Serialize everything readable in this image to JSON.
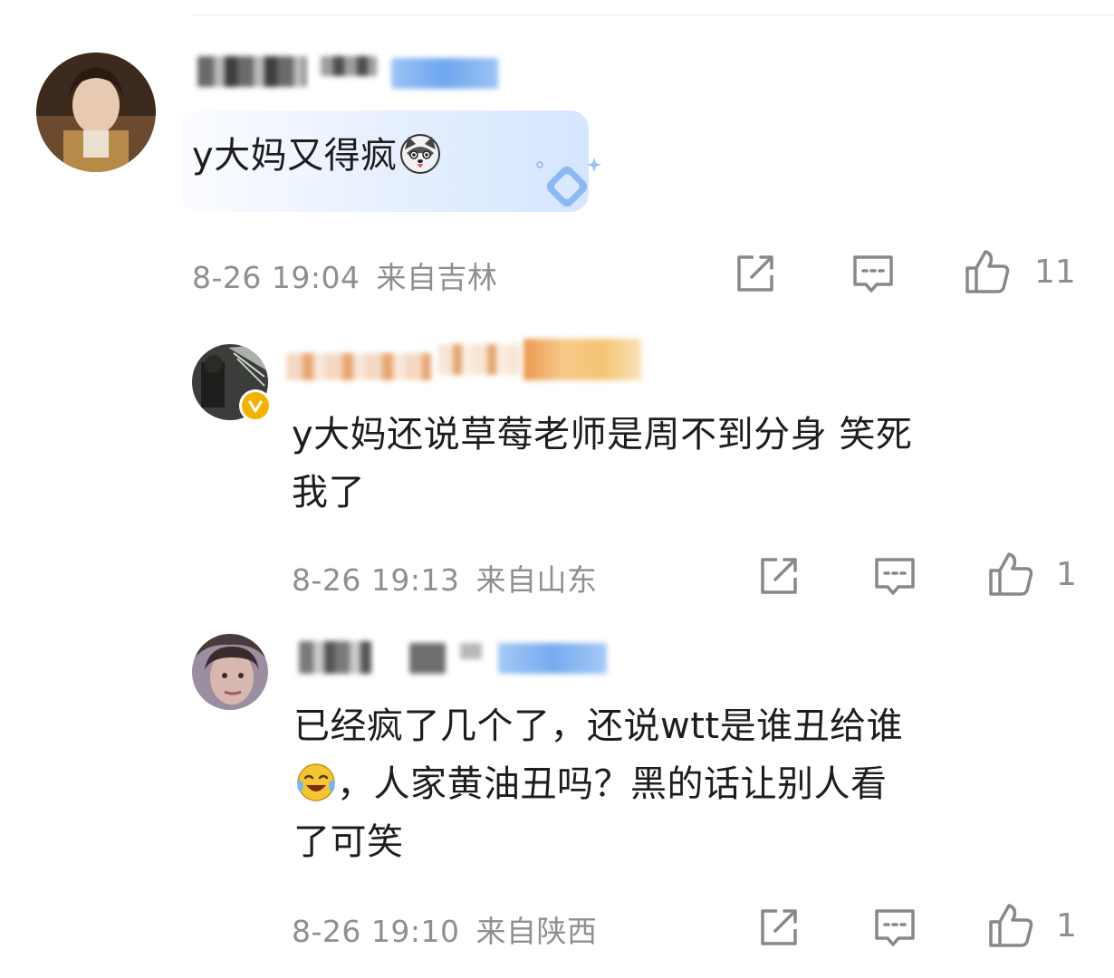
{
  "comments": [
    {
      "text_a": "y大妈又得疯",
      "text_b": "",
      "time": "8-26 19:04",
      "location": "来自吉林",
      "likes": "11",
      "emoji": "husky-face-emoji"
    },
    {
      "text_a": "y大妈还说草莓老师是周不到分身 笑死",
      "text_b": "我了",
      "time": "8-26 19:13",
      "location": "来自山东",
      "likes": "1"
    },
    {
      "text_a": "已经疯了几个了，还说wtt是谁丑给谁",
      "text_b": "，人家黄油丑吗？黑的话让别人看",
      "text_c": "了可笑",
      "time": "8-26 19:10",
      "location": "来自陕西",
      "likes": "1",
      "emoji": "laughing-crying-emoji"
    }
  ],
  "icons": {
    "share": "share-icon",
    "reply": "comment-icon",
    "like": "thumbs-up-icon",
    "verified": "verified-badge-icon"
  },
  "colors": {
    "meta_gray": "#8f8f8f",
    "bubble_blue": "#d6e6ff",
    "badge_gold": "#f0b400"
  }
}
